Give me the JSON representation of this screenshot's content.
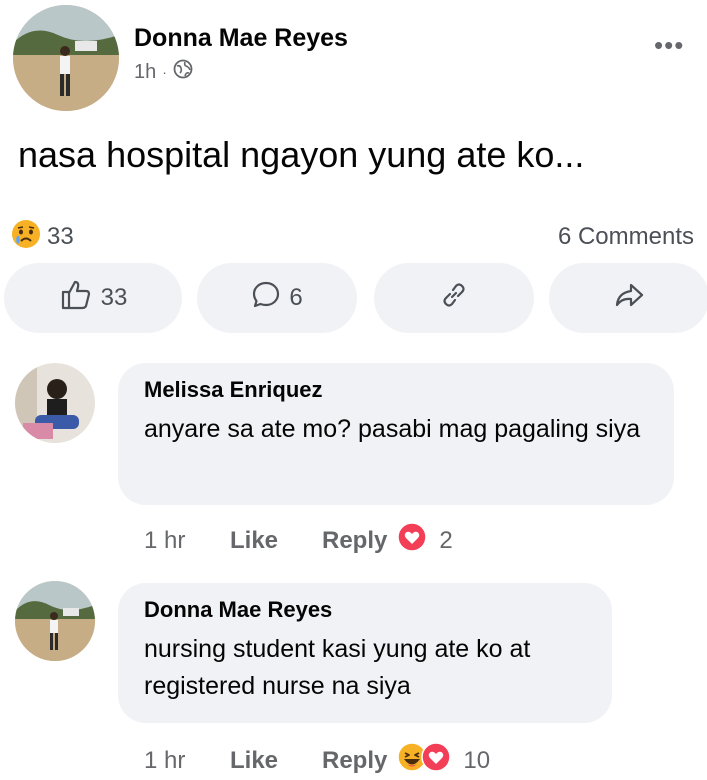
{
  "post": {
    "author": "Donna Mae Reyes",
    "time": "1h",
    "separator": "·",
    "more_label": "•••",
    "text": "nasa hospital ngayon yung ate ko...",
    "reaction_count": "33",
    "comments_summary": "6 Comments",
    "actions": {
      "like_count": "33",
      "comment_count": "6"
    }
  },
  "comments": [
    {
      "name": "Melissa Enriquez",
      "text": "anyare sa ate mo? pasabi mag pagaling siya",
      "time": "1 hr",
      "like_label": "Like",
      "reply_label": "Reply",
      "reaction_count": "2"
    },
    {
      "name": "Donna Mae Reyes",
      "text": "nursing student kasi yung ate ko at registered nurse na siya",
      "time": "1 hr",
      "like_label": "Like",
      "reply_label": "Reply",
      "reaction_count": "10"
    }
  ],
  "colors": {
    "text": "#050505",
    "secondary": "#65676b",
    "button_bg": "#f0f2f5",
    "love": "#f33e58",
    "haha": "#f7b125"
  },
  "icons": [
    "globe-icon",
    "sad-reaction-icon",
    "like-icon",
    "comment-icon",
    "link-icon",
    "share-icon",
    "love-reaction-icon",
    "haha-reaction-icon"
  ]
}
